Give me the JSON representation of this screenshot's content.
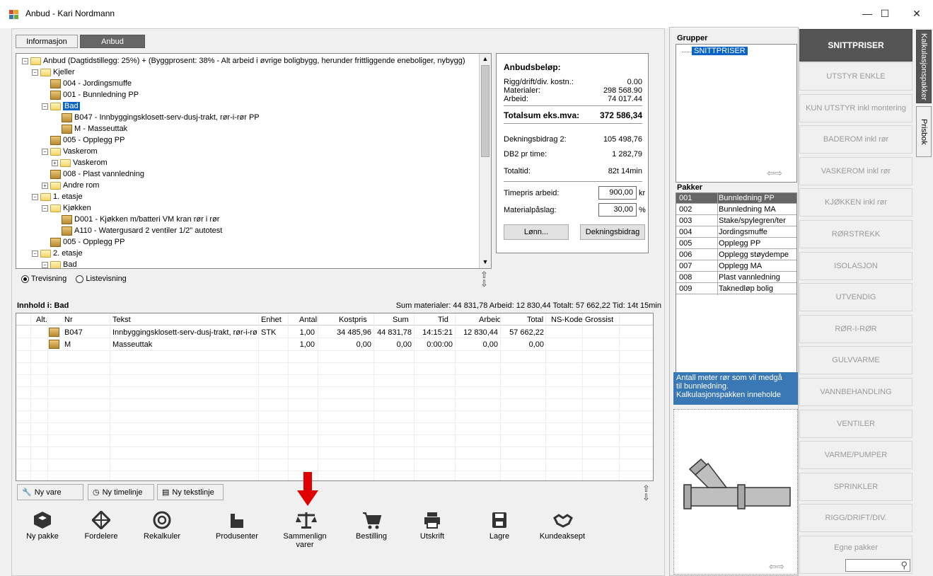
{
  "window": {
    "title": "Anbud - Kari Nordmann",
    "min": "—",
    "max": "☐",
    "close": "✕"
  },
  "tabs": [
    {
      "label": "Informasjon"
    },
    {
      "label": "Anbud"
    }
  ],
  "tree": {
    "rows": [
      {
        "text": "Anbud (Dagtidstillegg: 25%) + (Byggprosent: 38% - Alt arbeid i øvrige boligbygg, herunder frittliggende eneboliger, nybygg)"
      },
      {
        "text": "Kjeller"
      },
      {
        "text": "004 - Jordingsmuffe"
      },
      {
        "text": "001 - Bunnledning PP"
      },
      {
        "text": "Bad"
      },
      {
        "text": "B047 - Innbyggingsklosett-serv-dusj-trakt, rør-i-rør PP"
      },
      {
        "text": "M - Masseuttak"
      },
      {
        "text": "005 - Opplegg PP"
      },
      {
        "text": "Vaskerom"
      },
      {
        "text": "Vaskerom"
      },
      {
        "text": "008 - Plast vannledning"
      },
      {
        "text": "Andre rom"
      },
      {
        "text": "1. etasje"
      },
      {
        "text": "Kjøkken"
      },
      {
        "text": "D001 - Kjøkken m/batteri VM kran rør i rør"
      },
      {
        "text": "A110 - Watergusard 2  ventiler 1/2\" autotest"
      },
      {
        "text": "005 - Opplegg PP"
      },
      {
        "text": "2. etasje"
      },
      {
        "text": "Bad"
      }
    ]
  },
  "view": {
    "tree": "Trevisning",
    "list": "Listevisning"
  },
  "summary": {
    "heading": "Anbudsbeløp:",
    "rigg_label": "Rigg/drift/div. kostn.:",
    "rigg": "0.00",
    "mat_label": "Materialer:",
    "mat": "298 568.90",
    "arb_label": "Arbeid:",
    "arb": "74 017.44",
    "total_label": "Totalsum eks.mva:",
    "total": "372 586,34",
    "db2_label": "Dekningsbidrag 2:",
    "db2": "105 498,76",
    "db2t_label": "DB2 pr time:",
    "db2t": "1 282,79",
    "tid_label": "Totaltid:",
    "tid": "82t 14min",
    "timepris_label": "Timepris arbeid:",
    "timepris": "900,00",
    "timepris_unit": "kr",
    "paaslag_label": "Materialpåslag:",
    "paaslag": "30,00",
    "paaslag_unit": "%",
    "lonn_btn": "Lønn...",
    "db_btn": "Dekningsbidrag"
  },
  "content": {
    "title": "Innhold i: Bad",
    "totals": "Sum materialer:  44 831,78  Arbeid:  12 830,44  Totalt:  57 662,22  Tid:  14t 15min",
    "columns": [
      "Alt.",
      "Nr",
      "Tekst",
      "Enhet",
      "Antall",
      "Kostpris",
      "Sum",
      "Tid",
      "Arbeid",
      "Total",
      "NS-Kode",
      "Grossist"
    ],
    "rows": [
      {
        "nr": "B047",
        "tekst": "Innbyggingsklosett-serv-dusj-trakt, rør-i-rø...",
        "enhet": "STK",
        "antall": "1,00",
        "kostpris": "34 485,96",
        "sum": "44 831,78",
        "tid": "14:15:21",
        "arbeid": "12 830,44",
        "total": "57 662,22"
      },
      {
        "nr": "M",
        "tekst": "Masseuttak",
        "enhet": "",
        "antall": "1,00",
        "kostpris": "0,00",
        "sum": "0,00",
        "tid": "0:00:00",
        "arbeid": "0,00",
        "total": "0,00"
      }
    ]
  },
  "bottom_buttons": {
    "ny_vare": "Ny vare",
    "ny_timelinje": "Ny timelinje",
    "ny_tekstlinje": "Ny tekstlinje"
  },
  "toolbar": {
    "ny_pakke": "Ny pakke",
    "fordelere": "Fordelere",
    "rekalkuler": "Rekalkuler",
    "produsenter": "Produsenter",
    "sammenlign": "Sammenlign",
    "sammenlign2": "varer",
    "bestilling": "Bestilling",
    "utskrift": "Utskrift",
    "lagre": "Lagre",
    "kundeaksept": "Kundeaksept"
  },
  "grupper": {
    "title": "Grupper",
    "item": "SNITTPRISER"
  },
  "pakker": {
    "title": "Pakker",
    "rows": [
      {
        "code": "001",
        "name": "Bunnledning PP"
      },
      {
        "code": "002",
        "name": "Bunnledning MA"
      },
      {
        "code": "003",
        "name": "Stake/spylegren/ter"
      },
      {
        "code": "004",
        "name": "Jordingsmuffe"
      },
      {
        "code": "005",
        "name": "Opplegg PP"
      },
      {
        "code": "006",
        "name": "Opplegg støydempe"
      },
      {
        "code": "007",
        "name": "Opplegg MA"
      },
      {
        "code": "008",
        "name": "Plast vannledning"
      },
      {
        "code": "009",
        "name": "Taknedløp bolig"
      }
    ],
    "desc1": "Antall meter rør som vil medgå",
    "desc2": "til bunnledning.",
    "desc3": "Kalkulasjonspakken inneholde"
  },
  "categories": [
    "SNITTPRISER",
    "UTSTYR ENKLE",
    "KUN UTSTYR inkl montering",
    "BADEROM inkl rør",
    "VASKEROM inkl rør",
    "KJØKKEN inkl rør",
    "RØRSTREKK",
    "ISOLASJON",
    "UTVENDIG",
    "RØR-I-RØR",
    "GULVVARME",
    "VANNBEHANDLING",
    "VENTILER",
    "VARME/PUMPER",
    "SPRINKLER",
    "RIGG/DRIFT/DIV.",
    "Egne pakker"
  ],
  "sidetabs": {
    "kalk": "Kalkulasjonspakker",
    "prisbok": "Prisbok"
  },
  "colors": {
    "accent": "#0a64c8",
    "dark_btn": "#555555",
    "desc_bg": "#3a78b5",
    "arrow": "#e00000"
  }
}
